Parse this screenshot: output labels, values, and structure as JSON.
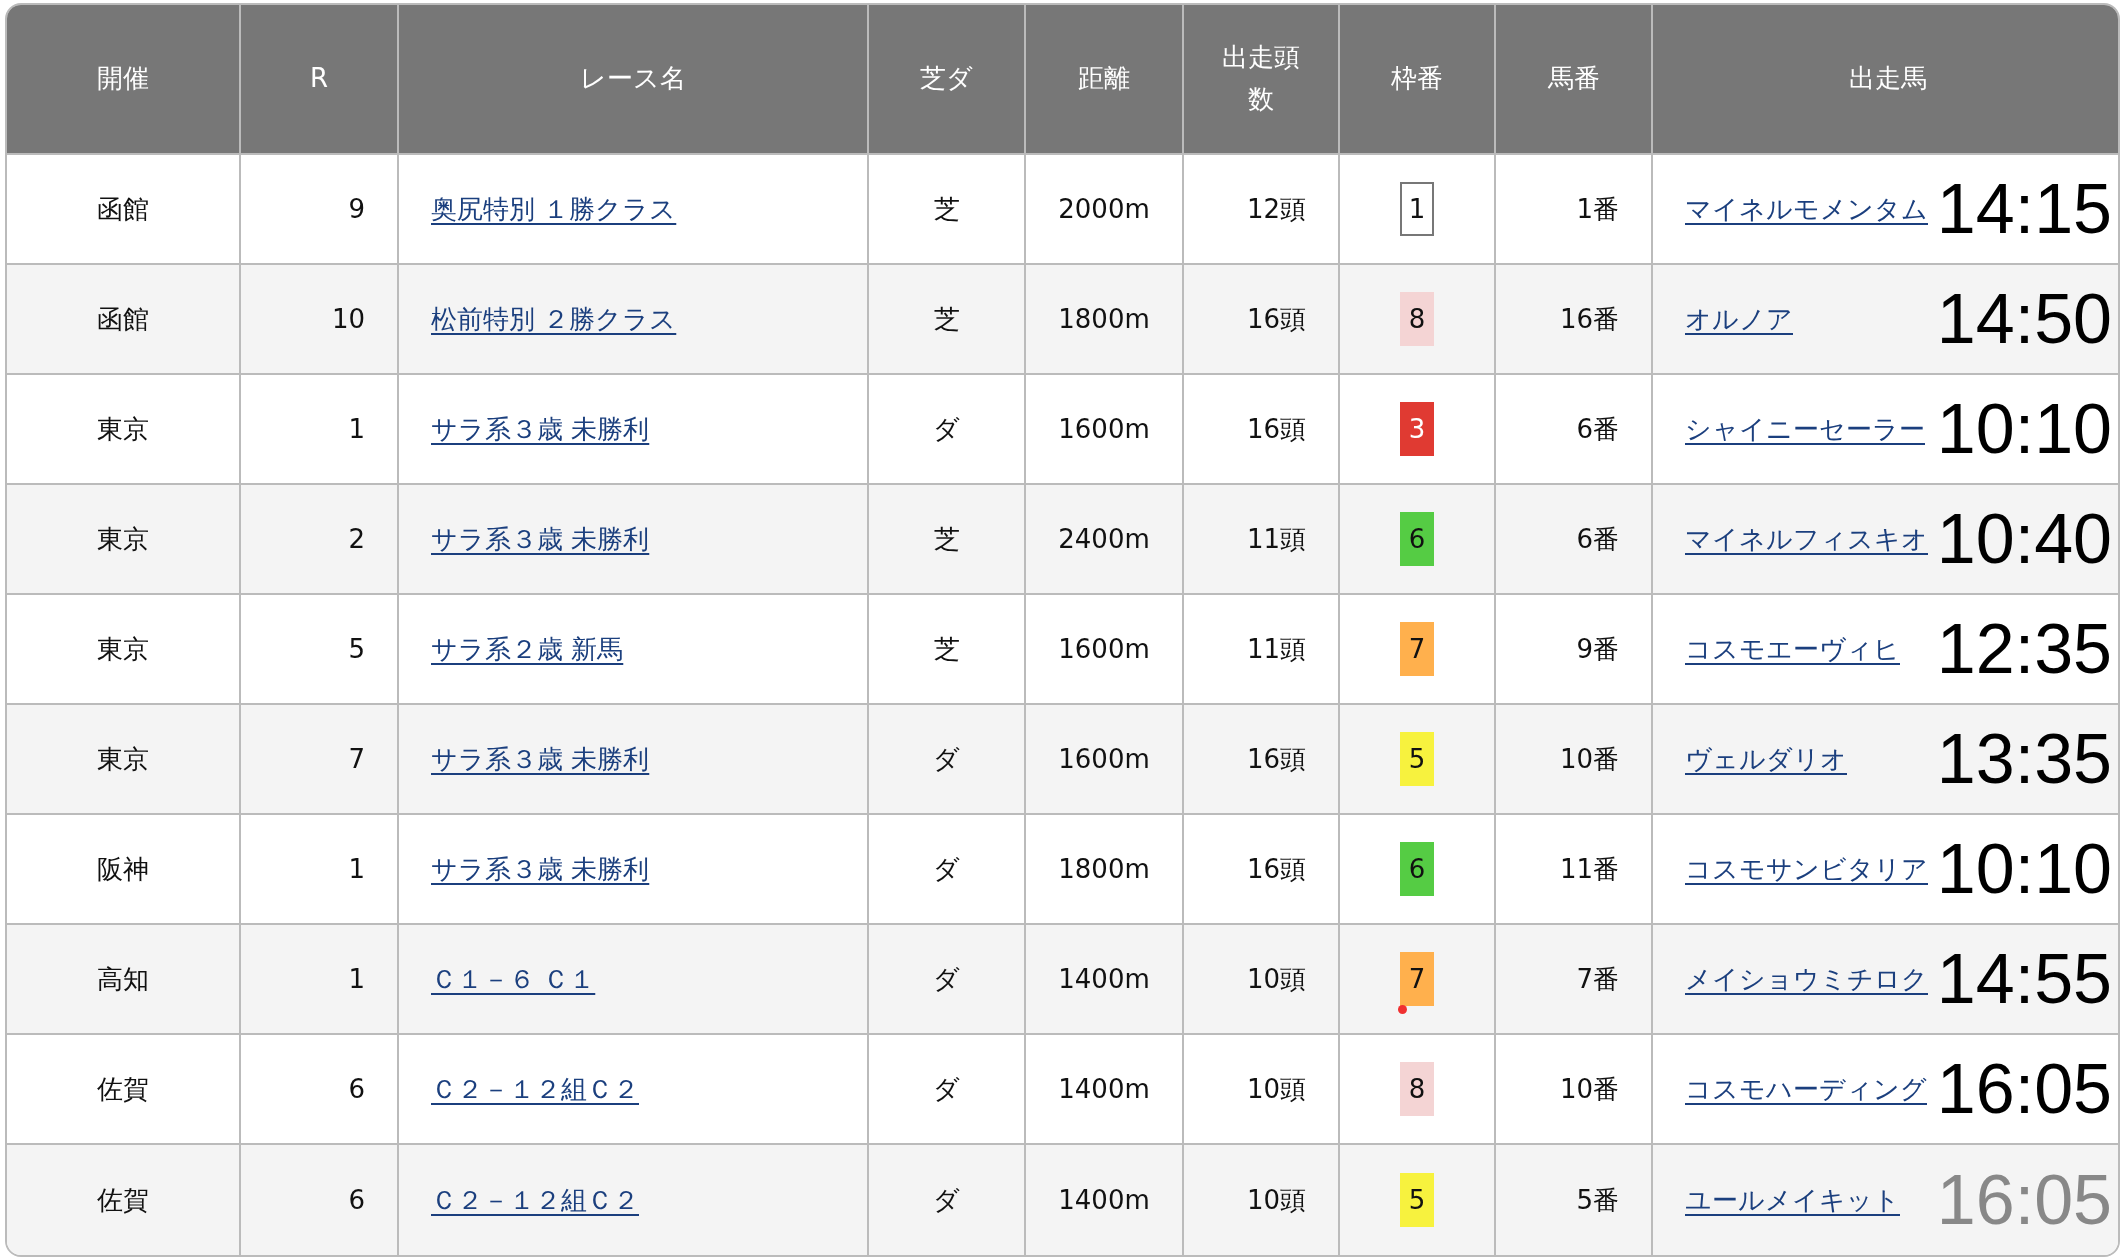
{
  "table": {
    "columns": [
      "開催",
      "R",
      "レース名",
      "芝ダ",
      "距離",
      "出走頭数",
      "枠番",
      "馬番",
      "出走馬"
    ],
    "rows": [
      {
        "venue": "函館",
        "race_no": "9",
        "race_name": "奥尻特別 １勝クラス",
        "surface": "芝",
        "distance": "2000m",
        "runners": "12頭",
        "frame": "1",
        "color": "#ffffff",
        "flagged": false,
        "horse_no": "1番",
        "horse": "マイネルモメンタム",
        "time": "14:15",
        "past": false
      },
      {
        "venue": "函館",
        "race_no": "10",
        "race_name": "松前特別 ２勝クラス",
        "surface": "芝",
        "distance": "1800m",
        "runners": "16頭",
        "frame": "8",
        "color": "#f4d4d4",
        "flagged": false,
        "horse_no": "16番",
        "horse": "オルノア",
        "time": "14:50",
        "past": false
      },
      {
        "venue": "東京",
        "race_no": "1",
        "race_name": "サラ系３歳 未勝利",
        "surface": "ダ",
        "distance": "1600m",
        "runners": "16頭",
        "frame": "3",
        "color": "#e03a32",
        "flagged": false,
        "horse_no": "6番",
        "horse": "シャイニーセーラー",
        "time": "10:10",
        "past": false
      },
      {
        "venue": "東京",
        "race_no": "2",
        "race_name": "サラ系３歳 未勝利",
        "surface": "芝",
        "distance": "2400m",
        "runners": "11頭",
        "frame": "6",
        "color": "#55cc44",
        "flagged": false,
        "horse_no": "6番",
        "horse": "マイネルフィスキオ",
        "time": "10:40",
        "past": false
      },
      {
        "venue": "東京",
        "race_no": "5",
        "race_name": "サラ系２歳 新馬",
        "surface": "芝",
        "distance": "1600m",
        "runners": "11頭",
        "frame": "7",
        "color": "#ffb04d",
        "flagged": false,
        "horse_no": "9番",
        "horse": "コスモエーヴィヒ",
        "time": "12:35",
        "past": false
      },
      {
        "venue": "東京",
        "race_no": "7",
        "race_name": "サラ系３歳 未勝利",
        "surface": "ダ",
        "distance": "1600m",
        "runners": "16頭",
        "frame": "5",
        "color": "#f7f23e",
        "flagged": false,
        "horse_no": "10番",
        "horse": "ヴェルダリオ",
        "time": "13:35",
        "past": false
      },
      {
        "venue": "阪神",
        "race_no": "1",
        "race_name": "サラ系３歳 未勝利",
        "surface": "ダ",
        "distance": "1800m",
        "runners": "16頭",
        "frame": "6",
        "color": "#55cc44",
        "flagged": false,
        "horse_no": "11番",
        "horse": "コスモサンビタリア",
        "time": "10:10",
        "past": false
      },
      {
        "venue": "高知",
        "race_no": "1",
        "race_name": "Ｃ１－６ Ｃ１",
        "surface": "ダ",
        "distance": "1400m",
        "runners": "10頭",
        "frame": "7",
        "color": "#ffb04d",
        "flagged": true,
        "horse_no": "7番",
        "horse": "メイショウミチロク",
        "time": "14:55",
        "past": false
      },
      {
        "venue": "佐賀",
        "race_no": "6",
        "race_name": "Ｃ２－１２組Ｃ２",
        "surface": "ダ",
        "distance": "1400m",
        "runners": "10頭",
        "frame": "8",
        "color": "#f4d4d4",
        "flagged": false,
        "horse_no": "10番",
        "horse": "コスモハーディング",
        "time": "16:05",
        "past": false
      },
      {
        "venue": "佐賀",
        "race_no": "6",
        "race_name": "Ｃ２－１２組Ｃ２",
        "surface": "ダ",
        "distance": "1400m",
        "runners": "10頭",
        "frame": "5",
        "color": "#f7f23e",
        "flagged": false,
        "horse_no": "5番",
        "horse": "ユールメイキット",
        "time": "16:05",
        "past": true
      }
    ]
  }
}
